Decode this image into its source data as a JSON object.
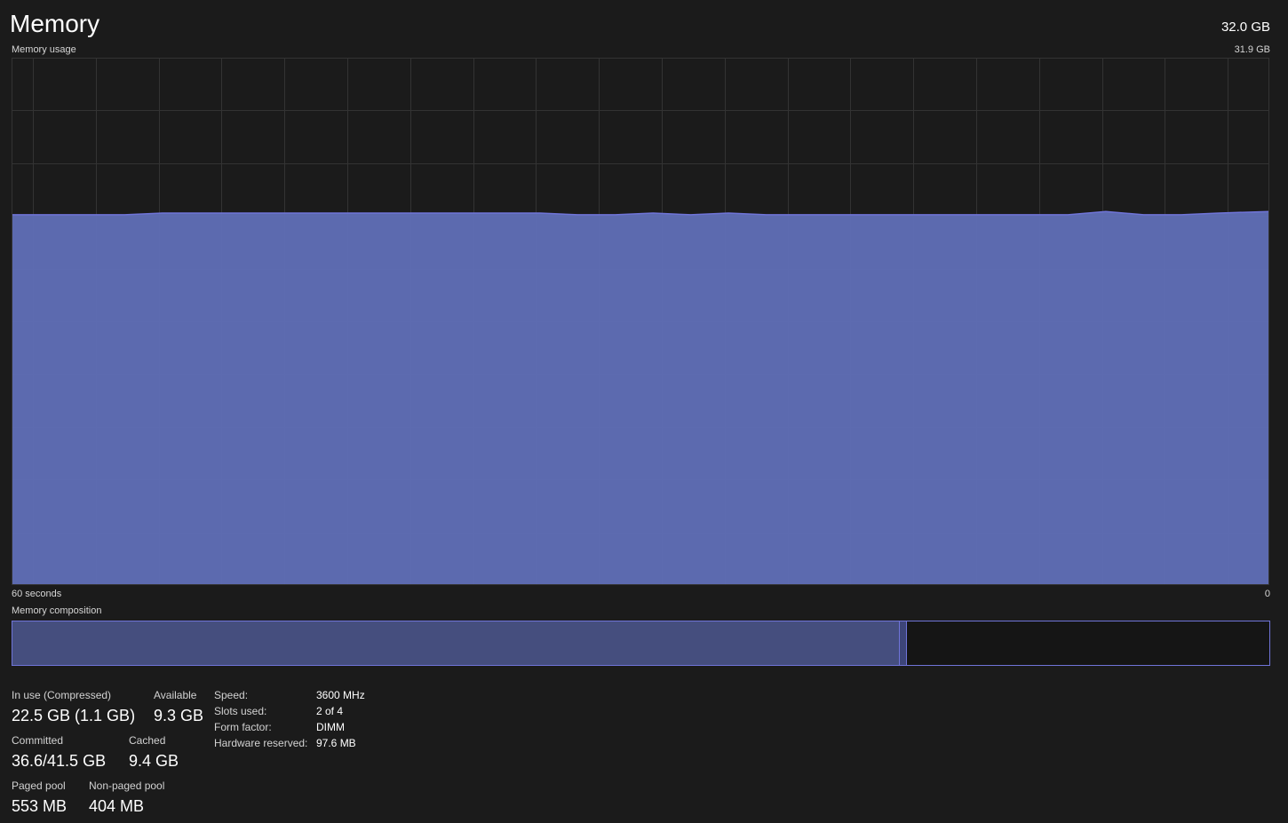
{
  "header": {
    "title": "Memory",
    "total": "32.0 GB",
    "graph_label": "Memory usage",
    "graph_max": "31.9 GB"
  },
  "graph": {
    "time_left_label": "60 seconds",
    "time_right_label": "0",
    "line_color": "#6f74d8",
    "fill_color": "#5f6db5",
    "grid_color": "#333333"
  },
  "chart_data": {
    "type": "area",
    "title": "Memory usage",
    "xlabel": "",
    "ylabel": "",
    "x": [
      60,
      58.2,
      56.4,
      54.6,
      52.8,
      51,
      49.2,
      47.4,
      45.6,
      43.8,
      42,
      40.2,
      38.4,
      36.6,
      34.8,
      33,
      31.2,
      29.4,
      27.6,
      25.8,
      24,
      22.2,
      20.4,
      18.6,
      16.8,
      15,
      13.2,
      11.4,
      9.6,
      7.8,
      6,
      4.2,
      2.4,
      0
    ],
    "values": [
      22.4,
      22.4,
      22.4,
      22.4,
      22.5,
      22.5,
      22.5,
      22.5,
      22.5,
      22.5,
      22.5,
      22.5,
      22.5,
      22.5,
      22.5,
      22.4,
      22.4,
      22.5,
      22.4,
      22.5,
      22.4,
      22.4,
      22.4,
      22.4,
      22.4,
      22.4,
      22.4,
      22.4,
      22.4,
      22.6,
      22.4,
      22.4,
      22.5,
      22.6
    ],
    "xlim": [
      60,
      0
    ],
    "ylim": [
      0,
      31.9
    ],
    "grid": true
  },
  "composition": {
    "label": "Memory composition",
    "in_use_fraction": 0.705,
    "modified_fraction": 0.005,
    "standby_fraction": 0.29,
    "in_use_color": "#454e7e",
    "border_color": "#6f74d8"
  },
  "stats": {
    "in_use_label": "In use (Compressed)",
    "in_use_value": "22.5 GB (1.1 GB)",
    "available_label": "Available",
    "available_value": "9.3 GB",
    "committed_label": "Committed",
    "committed_value": "36.6/41.5 GB",
    "cached_label": "Cached",
    "cached_value": "9.4 GB",
    "paged_pool_label": "Paged pool",
    "paged_pool_value": "553 MB",
    "non_paged_pool_label": "Non-paged pool",
    "non_paged_pool_value": "404 MB"
  },
  "specs": {
    "speed_label": "Speed:",
    "speed_value": "3600 MHz",
    "slots_label": "Slots used:",
    "slots_value": "2 of 4",
    "form_factor_label": "Form factor:",
    "form_factor_value": "DIMM",
    "hardware_reserved_label": "Hardware reserved:",
    "hardware_reserved_value": "97.6 MB"
  }
}
